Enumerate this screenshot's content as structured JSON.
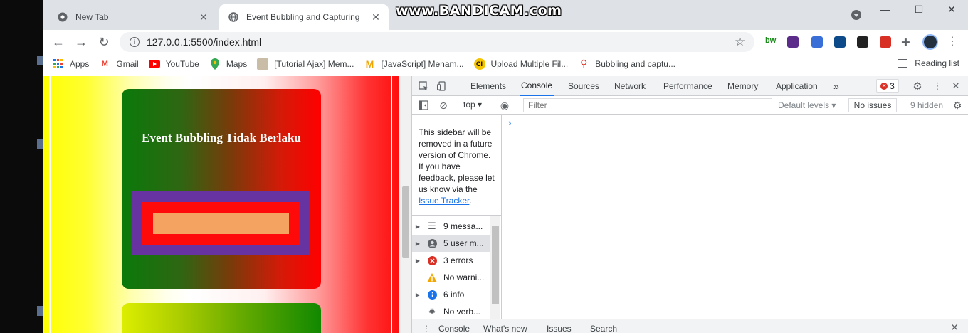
{
  "tabs": [
    {
      "title": "New Tab",
      "icon": "chrome-icon"
    },
    {
      "title": "Event Bubbling and Capturing",
      "icon": "globe-icon",
      "active": true
    }
  ],
  "watermark": "www.BANDICAM.com",
  "window_controls": {
    "minimize": "—",
    "maximize": "☐",
    "close": "✕"
  },
  "address_bar": {
    "url": "127.0.0.1:5500/index.html"
  },
  "bookmarks": [
    {
      "label": "Apps",
      "icon": "apps-grid-icon"
    },
    {
      "label": "Gmail",
      "icon": "gmail-icon"
    },
    {
      "label": "YouTube",
      "icon": "youtube-icon"
    },
    {
      "label": "Maps",
      "icon": "maps-icon"
    },
    {
      "label": "[Tutorial Ajax] Mem...",
      "icon": "avatar-icon"
    },
    {
      "label": "[JavaScript] Menam...",
      "icon": "medium-icon"
    },
    {
      "label": "Upload Multiple Fil...",
      "icon": "ci-icon"
    },
    {
      "label": "Bubbling and captu...",
      "icon": "pin-icon"
    }
  ],
  "reading_list": "Reading list",
  "page": {
    "heading": "Event Bubbling Tidak Berlaku",
    "colors": {
      "purple": "#6633a0",
      "red": "#ff0a0a",
      "orange": "#f4a460"
    }
  },
  "devtools": {
    "tabs": [
      "Elements",
      "Console",
      "Sources",
      "Network",
      "Performance",
      "Memory",
      "Application"
    ],
    "active_tab": "Console",
    "more": "»",
    "error_count": "3",
    "context": "top",
    "filter_placeholder": "Filter",
    "levels": "Default levels",
    "issues_button": "No issues",
    "hidden": "9 hidden",
    "sidebar_note_lines": [
      "This sidebar will be",
      "removed in a future",
      "version of Chrome.",
      "If you have",
      "feedback, please let",
      "us know via the"
    ],
    "sidebar_link": "Issue Tracker",
    "sidebar_items": [
      {
        "label": "9 messa...",
        "icon": "list-icon",
        "expandable": true
      },
      {
        "label": "5 user m...",
        "icon": "user-icon",
        "expandable": true,
        "selected": true
      },
      {
        "label": "3 errors",
        "icon": "error-icon",
        "expandable": true
      },
      {
        "label": "No warni...",
        "icon": "warning-icon",
        "expandable": false
      },
      {
        "label": "6 info",
        "icon": "info-icon",
        "expandable": true
      },
      {
        "label": "No verb...",
        "icon": "bug-icon",
        "expandable": false
      }
    ],
    "prompt": "›",
    "drawer_tabs": [
      "Console",
      "What's new",
      "Issues",
      "Search"
    ]
  }
}
